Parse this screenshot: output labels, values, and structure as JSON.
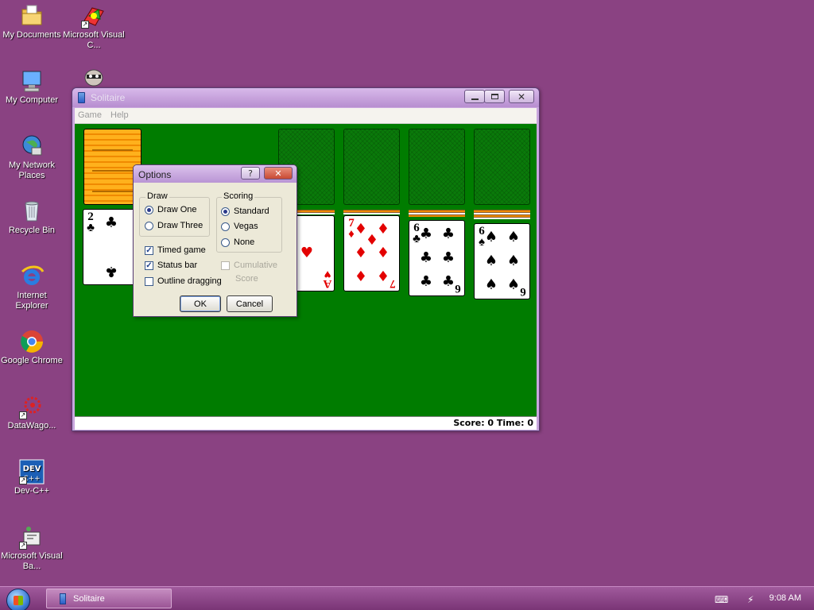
{
  "desktop": {
    "icons": [
      {
        "label": "My Documents",
        "icon": "folder-icon"
      },
      {
        "label": "Microsoft Visual C...",
        "icon": "visual-cpp-icon"
      },
      {
        "label": "My Computer",
        "icon": "computer-icon"
      },
      {
        "label": "My Network Places",
        "icon": "network-icon"
      },
      {
        "label": "Recycle Bin",
        "icon": "recycle-bin-icon"
      },
      {
        "label": "Internet Explorer",
        "icon": "internet-explorer-icon"
      },
      {
        "label": "Google Chrome",
        "icon": "chrome-icon"
      },
      {
        "label": "DataWago...",
        "icon": "datawagon-icon"
      },
      {
        "label": "Dev-C++",
        "icon": "devcpp-icon"
      },
      {
        "label": "Microsoft Visual Ba...",
        "icon": "visual-basic-icon"
      }
    ]
  },
  "solitaire": {
    "title": "Solitaire",
    "menu": {
      "game": "Game",
      "help": "Help"
    },
    "status": "Score: 0 Time: 0",
    "cards": {
      "waste": {
        "rank": "2",
        "suit": "♣"
      },
      "t_ace": {
        "rank": "A",
        "suit": "♥"
      },
      "t_seven": {
        "rank": "7",
        "suit": "♦"
      },
      "t_six_c": {
        "rank": "6",
        "suit": "♣"
      },
      "t_six_s": {
        "rank": "6",
        "suit": "♠"
      }
    }
  },
  "options_dialog": {
    "title": "Options",
    "help_button": "?",
    "close_button": "✕",
    "draw": {
      "label": "Draw",
      "one": "Draw One",
      "three": "Draw Three",
      "selected": "Draw One"
    },
    "scoring": {
      "label": "Scoring",
      "standard": "Standard",
      "vegas": "Vegas",
      "none": "None",
      "selected": "Standard"
    },
    "checkboxes": {
      "timed_game": "Timed game",
      "timed_game_checked": true,
      "status_bar": "Status bar",
      "status_bar_checked": true,
      "outline_dragging": "Outline dragging",
      "outline_dragging_checked": false,
      "cumulative": "Cumulative",
      "cumulative_2": "Score",
      "cumulative_checked": false
    },
    "ok": "OK",
    "cancel": "Cancel"
  },
  "taskbar": {
    "task": "Solitaire",
    "clock": "9:08 AM"
  }
}
